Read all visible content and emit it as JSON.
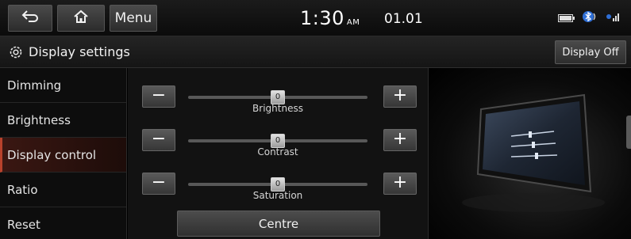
{
  "topbar": {
    "menu_label": "Menu",
    "time": "1:30",
    "ampm": "AM",
    "date": "01.01",
    "icons": [
      "back-icon",
      "home-icon",
      "battery-icon",
      "bluetooth-icon",
      "signal-icon"
    ]
  },
  "titlebar": {
    "title": "Display settings",
    "display_off_label": "Display Off",
    "icon": "gear-icon"
  },
  "sidebar": {
    "items": [
      {
        "label": "Dimming"
      },
      {
        "label": "Brightness"
      },
      {
        "label": "Display control"
      },
      {
        "label": "Ratio"
      },
      {
        "label": "Reset"
      }
    ],
    "active_index": 2
  },
  "controls": {
    "sliders": [
      {
        "label": "Brightness",
        "value": "0",
        "level": 0.5
      },
      {
        "label": "Contrast",
        "value": "0",
        "level": 0.5
      },
      {
        "label": "Saturation",
        "value": "0",
        "level": 0.5
      }
    ],
    "minus_symbol": "−",
    "plus_symbol": "+",
    "centre_label": "Centre"
  },
  "colors": {
    "accent": "#b8422c",
    "background": "#000000"
  }
}
